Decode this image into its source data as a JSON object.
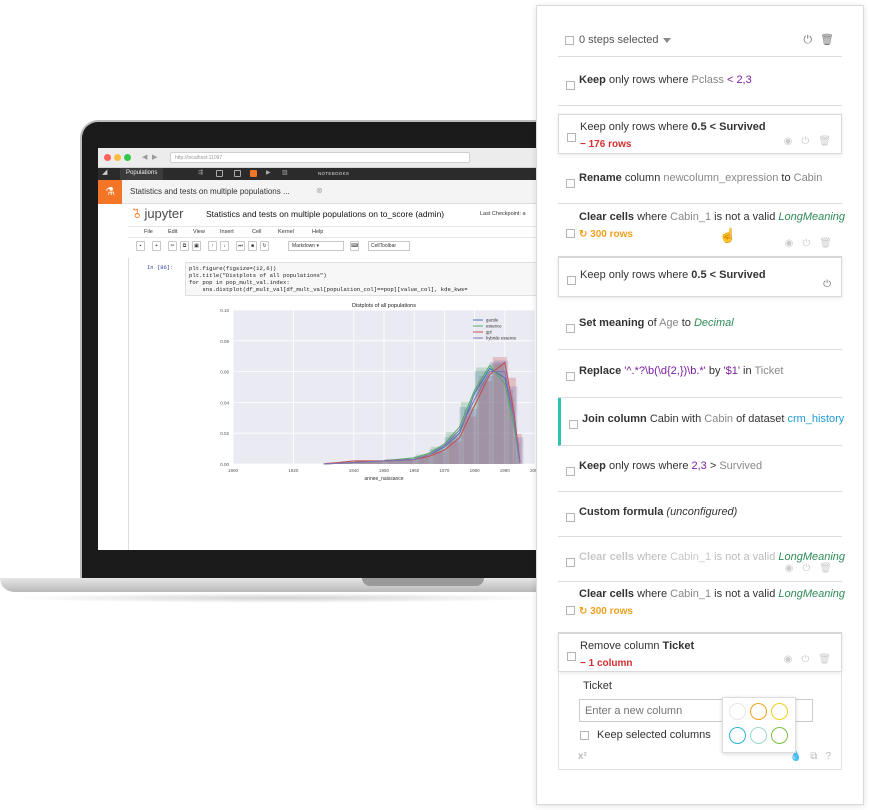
{
  "laptop": {
    "browser": {
      "url": "http://localhost:11097",
      "app_tab": "Populations",
      "notebooks_label": "NOTEBOOKS",
      "tab_title": "Statistics and tests on multiple populations ...",
      "tab_close": "⊗"
    },
    "jupyter": {
      "logo": "jupyter",
      "title": "Statistics and tests on multiple populations on to_score (admin)",
      "checkpoint": "Last Checkpoint: a",
      "menu": [
        "File",
        "Edit",
        "View",
        "Insert",
        "Cell",
        "Kernel",
        "Help"
      ],
      "cell_type": "Markdown",
      "celltoolbar_label": "CellToolbar",
      "prompt": "In [86]:",
      "code_lines": [
        "plt.figure(figsize=(12,6))",
        "plt.title(\"Distplots of all populations\")",
        "for pop in pop_mult_val.index:",
        "    sns.distplot(df_mult_val[df_mult_val[population_col]==pop][value_col], kde_kws="
      ]
    }
  },
  "chart_data": {
    "type": "area",
    "title": "Distplots of all populations",
    "xlabel": "annee_naissance",
    "ylabel": "",
    "xlim": [
      1900,
      2000
    ],
    "ylim": [
      0,
      0.1
    ],
    "x_ticks": [
      "1900",
      "1920",
      "1940",
      "1950",
      "1960",
      "1970",
      "1980",
      "1990",
      "2000"
    ],
    "y_ticks": [
      "0.00",
      "0.02",
      "0.04",
      "0.06",
      "0.08",
      "0.10"
    ],
    "legend_position": "top-right",
    "grid": true,
    "series": [
      {
        "name": "gazole",
        "color": "#4c72b0",
        "x": [
          1930,
          1940,
          1950,
          1960,
          1965,
          1970,
          1975,
          1980,
          1985,
          1990,
          1993,
          1995
        ],
        "values": [
          0.0,
          0.001,
          0.002,
          0.003,
          0.006,
          0.011,
          0.02,
          0.046,
          0.062,
          0.056,
          0.03,
          0.001
        ]
      },
      {
        "name": "essence",
        "color": "#55a868",
        "x": [
          1930,
          1940,
          1950,
          1960,
          1965,
          1970,
          1975,
          1980,
          1985,
          1990,
          1993,
          1995
        ],
        "values": [
          0.0,
          0.001,
          0.002,
          0.004,
          0.007,
          0.013,
          0.024,
          0.048,
          0.064,
          0.052,
          0.025,
          0.001
        ]
      },
      {
        "name": "gpl",
        "color": "#c44e52",
        "x": [
          1930,
          1940,
          1950,
          1960,
          1965,
          1970,
          1975,
          1980,
          1985,
          1990,
          1993,
          1995
        ],
        "values": [
          0.0,
          0.002,
          0.002,
          0.003,
          0.005,
          0.009,
          0.017,
          0.038,
          0.058,
          0.066,
          0.034,
          0.001
        ]
      },
      {
        "name": "hybride essence",
        "color": "#8172b2",
        "x": [
          1930,
          1940,
          1950,
          1960,
          1965,
          1970,
          1975,
          1980,
          1985,
          1990,
          1993,
          1995
        ],
        "values": [
          0.0,
          0.001,
          0.002,
          0.003,
          0.006,
          0.012,
          0.022,
          0.042,
          0.06,
          0.06,
          0.03,
          0.001
        ]
      }
    ]
  },
  "panel": {
    "header": {
      "selected": "0 steps selected"
    },
    "steps": [
      {
        "parts": [
          [
            "b",
            "Keep"
          ],
          [
            "t",
            " only rows where "
          ],
          [
            "g",
            "Pclass"
          ],
          [
            "p",
            " < 2,3"
          ]
        ],
        "meta": ""
      },
      {
        "parts": [
          [
            "t",
            "Keep only rows where "
          ],
          [
            "b",
            "0.5 < Survived"
          ]
        ],
        "meta": "− 176 rows",
        "meta_kind": "red"
      },
      {
        "parts": [
          [
            "b",
            "Rename"
          ],
          [
            "t",
            " column "
          ],
          [
            "g",
            "newcolumn_expression"
          ],
          [
            "t",
            " to "
          ],
          [
            "g",
            "Cabin"
          ]
        ],
        "meta": ""
      },
      {
        "parts": [
          [
            "b",
            "Clear cells"
          ],
          [
            "t",
            " where "
          ],
          [
            "g",
            "Cabin_1"
          ],
          [
            "t",
            " is not a valid "
          ],
          [
            "gr",
            "LongMeaning"
          ]
        ],
        "meta": "300 rows",
        "meta_kind": "org"
      },
      {
        "parts": [
          [
            "t",
            "Keep only rows where "
          ],
          [
            "b",
            "0.5 < Survived"
          ]
        ],
        "meta": ""
      },
      {
        "parts": [
          [
            "b",
            "Set meaning"
          ],
          [
            "t",
            " of "
          ],
          [
            "g",
            "Age"
          ],
          [
            "t",
            " to "
          ],
          [
            "gr",
            "Decimal"
          ]
        ],
        "meta": ""
      },
      {
        "parts": [
          [
            "b",
            "Replace"
          ],
          [
            "p",
            " '^.*?\\b(\\d{2,})\\b.*'"
          ],
          [
            "t",
            " by "
          ],
          [
            "p",
            "'$1'"
          ],
          [
            "t",
            " in "
          ],
          [
            "g",
            "Ticket"
          ]
        ],
        "meta": ""
      },
      {
        "parts": [
          [
            "b",
            "Join column"
          ],
          [
            "t",
            " Cabin with "
          ],
          [
            "g",
            "Cabin"
          ],
          [
            "t",
            " of dataset "
          ],
          [
            "bl",
            "crm_history"
          ]
        ],
        "meta": ""
      },
      {
        "parts": [
          [
            "b",
            "Keep"
          ],
          [
            "t",
            " only rows where "
          ],
          [
            "p",
            "2,3"
          ],
          [
            "t",
            " > "
          ],
          [
            "g",
            "Survived"
          ]
        ],
        "meta": ""
      },
      {
        "parts": [
          [
            "b",
            "Custom formula"
          ],
          [
            "t",
            " "
          ],
          [
            "i",
            "(unconfigured)"
          ]
        ],
        "meta": ""
      },
      {
        "parts": [
          [
            "b",
            "Clear cells"
          ],
          [
            "t",
            " where "
          ],
          [
            "g",
            "Cabin_1"
          ],
          [
            "t",
            " is not a valid "
          ],
          [
            "gr",
            "LongMeaning"
          ]
        ],
        "meta": ""
      },
      {
        "parts": [
          [
            "b",
            "Clear cells"
          ],
          [
            "t",
            " where "
          ],
          [
            "g",
            "Cabin_1"
          ],
          [
            "t",
            " is not a valid "
          ],
          [
            "gr",
            "LongMeaning"
          ]
        ],
        "meta": "300 rows",
        "meta_kind": "org"
      },
      {
        "parts": [
          [
            "t",
            "Remove column "
          ],
          [
            "b",
            "Ticket"
          ]
        ],
        "meta": "− 1 column",
        "meta_kind": "red"
      }
    ],
    "form": {
      "column_label": "Ticket",
      "input_placeholder": "Enter a new column",
      "checkbox_label": "Keep selected columns",
      "formula_icon": "x²"
    },
    "palette_colors": [
      "#e6e6e6",
      "#f0a020",
      "#f0d020",
      "#2bb3d6",
      "#9fd6cf",
      "#7bc043"
    ],
    "icons": {
      "power": "power-icon",
      "trash": "trash-icon",
      "eye": "eye-icon",
      "copy": "copy-icon",
      "drop": "drop-icon",
      "help": "help-icon",
      "refresh": "refresh-icon",
      "cursor": "hand-cursor-icon"
    }
  }
}
